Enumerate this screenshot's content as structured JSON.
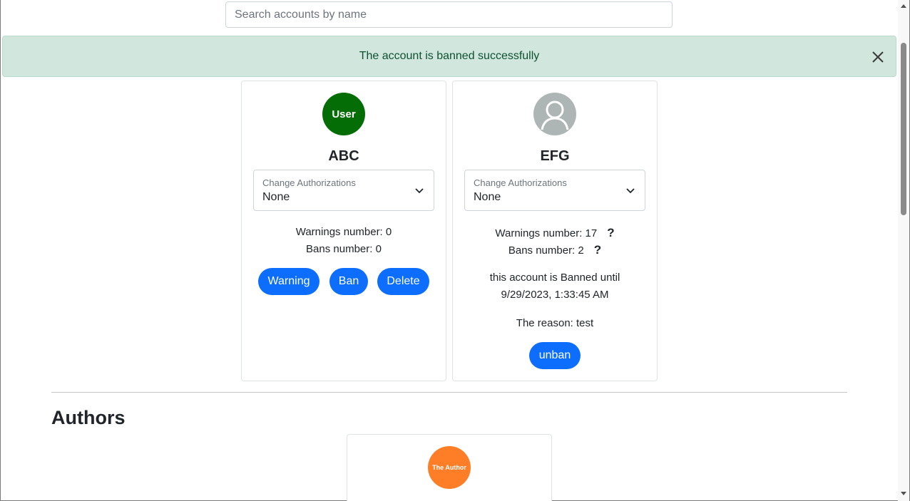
{
  "search": {
    "placeholder": "Search accounts by name"
  },
  "alert": {
    "message": "The account is banned successfully",
    "close_icon": "close-icon"
  },
  "accounts": [
    {
      "avatar_text": "User",
      "avatar_color": "#056d05",
      "name": "ABC",
      "authorization": {
        "label": "Change Authorizations",
        "value": "None"
      },
      "warnings_text": "Warnings number: 0",
      "bans_text": "Bans number: 0",
      "buttons": {
        "warning": "Warning",
        "ban": "Ban",
        "delete": "Delete"
      }
    },
    {
      "avatar_icon": "person-icon",
      "avatar_color": "#adb5b5",
      "name": "EFG",
      "authorization": {
        "label": "Change Authorizations",
        "value": "None"
      },
      "warnings_text": "Warnings number: 17",
      "bans_text": "Bans number: 2",
      "help_symbol": "?",
      "ban_status_line1": "this account is Banned until",
      "ban_status_line2": "9/29/2023, 1:33:45 AM",
      "reason": "The reason: test",
      "buttons": {
        "unban": "unban"
      }
    }
  ],
  "authors_section": {
    "title": "Authors",
    "cards": [
      {
        "avatar_text": "The Author",
        "avatar_color": "#fd7e27"
      }
    ]
  },
  "colors": {
    "primary": "#0d6efd",
    "alert_bg": "#d1e7dd",
    "alert_text": "#0f5132"
  }
}
